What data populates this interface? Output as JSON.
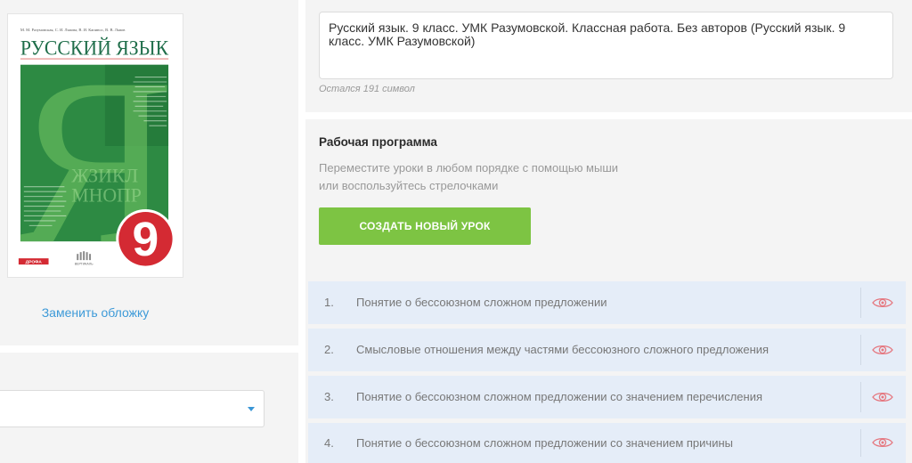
{
  "left": {
    "cover": {
      "authors": "М. М. Разумовская, С. И. Львова, В. И. Капинос, В. В. Львов",
      "title": "РУССКИЙ ЯЗЫК",
      "big_letter": "Я",
      "decor_letters": [
        "ЖЗИКЛ",
        "МНОПР"
      ],
      "grade": "9",
      "publisher_logo": "ДРОФА",
      "imprint_logo": "ВЕРТИКАЛЬ"
    },
    "replace_cover_link": "Заменить обложку",
    "select": {
      "icon": "caret-down-icon"
    }
  },
  "title_field": {
    "value": "Русский язык. 9 класс. УМК Разумовской. Классная работа. Без авторов (Русский язык. 9 класс. УМК Разумовской)",
    "counter": "Остался 191 символ"
  },
  "program": {
    "heading": "Рабочая программа",
    "hint": [
      "Переместите уроки в любом порядке с помощью мыши",
      "или воспользуйтесь стрелочками"
    ],
    "create_button": "СОЗДАТЬ НОВЫЙ УРОК",
    "lessons": [
      {
        "number": "1.",
        "title": "Понятие о бессоюзном сложном предложении",
        "icon": "eye-icon"
      },
      {
        "number": "2.",
        "title": "Смысловые отношения между частями бессоюзного сложного предложения",
        "icon": "eye-icon"
      },
      {
        "number": "3.",
        "title": "Понятие о бессоюзном сложном предложении со значением перечисления",
        "icon": "eye-icon"
      },
      {
        "number": "4.",
        "title": "Понятие о бессоюзном сложном предложении со значением причины",
        "icon": "eye-icon"
      }
    ]
  },
  "colors": {
    "panel_bg": "#f4f4f4",
    "link": "#3d9ad8",
    "button_bg": "#7dc443",
    "lesson_bg": "#e5edf8",
    "eye_icon": "#e57880",
    "select_caret": "#3a96d6",
    "cover_green": "#2d8a43",
    "cover_title": "#1f6e4a",
    "grade_badge": "#d42a33"
  }
}
